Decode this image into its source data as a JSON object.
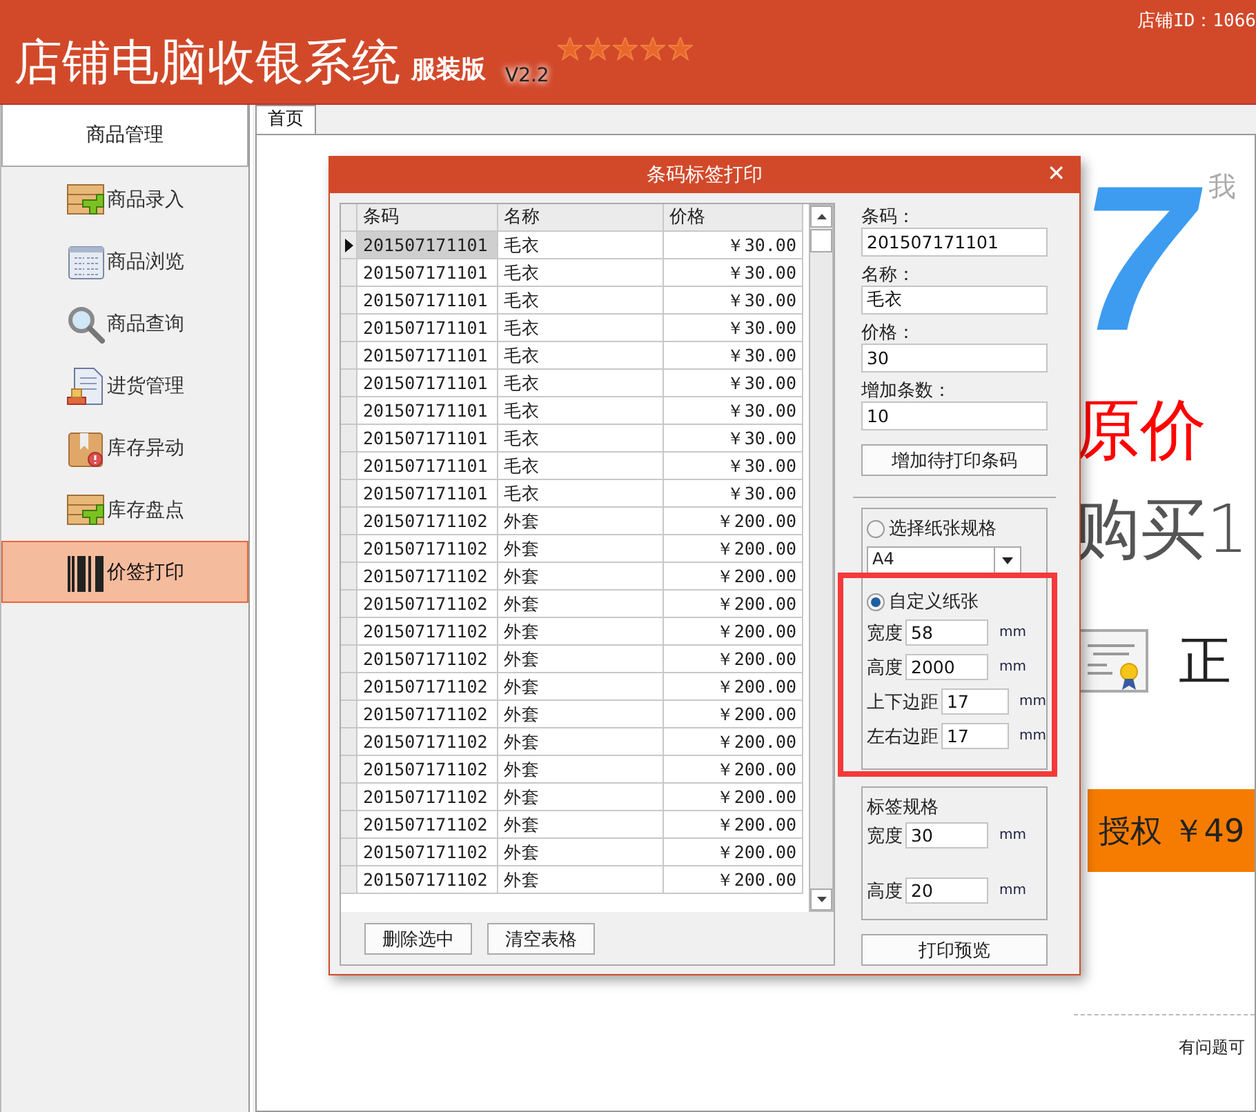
{
  "header": {
    "title": "店铺电脑收银系统",
    "edition": "服装版",
    "version": "V2.2",
    "stars": 5,
    "store_id": "店铺ID：1066"
  },
  "sidebar": {
    "heading": "商品管理",
    "items": [
      {
        "label": "商品录入",
        "kind": "crate-plus",
        "selected": false
      },
      {
        "label": "商品浏览",
        "kind": "list",
        "selected": false
      },
      {
        "label": "商品查询",
        "kind": "search",
        "selected": false
      },
      {
        "label": "进货管理",
        "kind": "document",
        "selected": false
      },
      {
        "label": "库存异动",
        "kind": "package",
        "selected": false
      },
      {
        "label": "库存盘点",
        "kind": "crate-plus",
        "selected": false
      },
      {
        "label": "价签打印",
        "kind": "barcode",
        "selected": true
      }
    ]
  },
  "tabs": [
    {
      "label": "首页",
      "selected": true
    }
  ],
  "banner": {
    "headline_number": "7",
    "side_text": "我",
    "line_1": "原价",
    "line_2": "购买1",
    "badge_text": "正",
    "price_button": "授权 ￥49",
    "help_text": "有问题可"
  },
  "dialog": {
    "title": "条码标签打印",
    "close": "✕",
    "table": {
      "columns": [
        "条码",
        "名称",
        "价格"
      ],
      "rows": [
        {
          "cells": [
            "201507171101",
            "毛衣",
            "￥30.00"
          ],
          "selected": true
        },
        {
          "cells": [
            "201507171101",
            "毛衣",
            "￥30.00"
          ],
          "selected": false
        },
        {
          "cells": [
            "201507171101",
            "毛衣",
            "￥30.00"
          ],
          "selected": false
        },
        {
          "cells": [
            "201507171101",
            "毛衣",
            "￥30.00"
          ],
          "selected": false
        },
        {
          "cells": [
            "201507171101",
            "毛衣",
            "￥30.00"
          ],
          "selected": false
        },
        {
          "cells": [
            "201507171101",
            "毛衣",
            "￥30.00"
          ],
          "selected": false
        },
        {
          "cells": [
            "201507171101",
            "毛衣",
            "￥30.00"
          ],
          "selected": false
        },
        {
          "cells": [
            "201507171101",
            "毛衣",
            "￥30.00"
          ],
          "selected": false
        },
        {
          "cells": [
            "201507171101",
            "毛衣",
            "￥30.00"
          ],
          "selected": false
        },
        {
          "cells": [
            "201507171101",
            "毛衣",
            "￥30.00"
          ],
          "selected": false
        },
        {
          "cells": [
            "201507171102",
            "外套",
            "￥200.00"
          ],
          "selected": false
        },
        {
          "cells": [
            "201507171102",
            "外套",
            "￥200.00"
          ],
          "selected": false
        },
        {
          "cells": [
            "201507171102",
            "外套",
            "￥200.00"
          ],
          "selected": false
        },
        {
          "cells": [
            "201507171102",
            "外套",
            "￥200.00"
          ],
          "selected": false
        },
        {
          "cells": [
            "201507171102",
            "外套",
            "￥200.00"
          ],
          "selected": false
        },
        {
          "cells": [
            "201507171102",
            "外套",
            "￥200.00"
          ],
          "selected": false
        },
        {
          "cells": [
            "201507171102",
            "外套",
            "￥200.00"
          ],
          "selected": false
        },
        {
          "cells": [
            "201507171102",
            "外套",
            "￥200.00"
          ],
          "selected": false
        },
        {
          "cells": [
            "201507171102",
            "外套",
            "￥200.00"
          ],
          "selected": false
        },
        {
          "cells": [
            "201507171102",
            "外套",
            "￥200.00"
          ],
          "selected": false
        },
        {
          "cells": [
            "201507171102",
            "外套",
            "￥200.00"
          ],
          "selected": false
        },
        {
          "cells": [
            "201507171102",
            "外套",
            "￥200.00"
          ],
          "selected": false
        },
        {
          "cells": [
            "201507171102",
            "外套",
            "￥200.00"
          ],
          "selected": false
        },
        {
          "cells": [
            "201507171102",
            "外套",
            "￥200.00"
          ],
          "selected": false
        }
      ]
    },
    "buttons": [
      "删除选中",
      "清空表格"
    ],
    "fields": [
      {
        "label": "条码：",
        "value": "201507171101"
      },
      {
        "label": "名称：",
        "value": "毛衣"
      },
      {
        "label": "价格：",
        "value": "30"
      },
      {
        "label": "增加条数：",
        "value": "10"
      }
    ],
    "add_button": "增加待打印条码",
    "paper": [
      {
        "kind": "preset",
        "label": "选择纸张规格",
        "selected": false,
        "value": "A4"
      },
      {
        "kind": "custom",
        "label": "自定义纸张",
        "selected": true,
        "highlighted": true,
        "fields": [
          {
            "label": "宽度",
            "value": "58",
            "unit": "mm"
          },
          {
            "label": "高度",
            "value": "2000",
            "unit": "mm"
          },
          {
            "label": "上下边距",
            "value": "17",
            "unit": "mm"
          },
          {
            "label": "左右边距",
            "value": "17",
            "unit": "mm"
          }
        ]
      }
    ],
    "label_spec": {
      "title": "标签规格",
      "fields": [
        {
          "label": "宽度",
          "value": "30",
          "unit": "mm"
        },
        {
          "label": "高度",
          "value": "20",
          "unit": "mm"
        }
      ]
    },
    "preview_button": "打印预览"
  }
}
